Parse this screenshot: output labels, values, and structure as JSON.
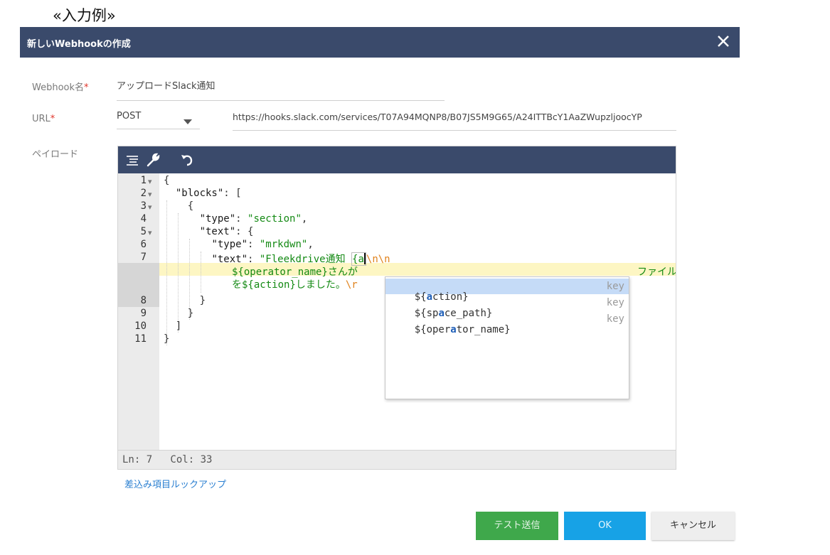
{
  "caption": "«入力例»",
  "dialog": {
    "title": "新しいWebhookの作成",
    "close_icon": "close-icon"
  },
  "form": {
    "name_label": "Webhook名",
    "name_value": "アップロードSlack通知",
    "url_label": "URL",
    "method_value": "POST",
    "url_value": "https://hooks.slack.com/services/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",
    "payload_label": "ペイロード",
    "required_mark": "*"
  },
  "editor": {
    "toolbar_icons": [
      "format-icon",
      "wrench-icon",
      "undo-icon"
    ],
    "line_numbers": [
      "1",
      "2",
      "3",
      "4",
      "5",
      "6",
      "7",
      "8",
      "9",
      "10",
      "11"
    ],
    "code": {
      "l1": "{",
      "l2_key": "\"blocks\"",
      "l2_rest": ": [",
      "l3": "{",
      "l4_key": "\"type\"",
      "l4_colon": ": ",
      "l4_val": "\"section\"",
      "l4_comma": ",",
      "l5_key": "\"text\"",
      "l5_rest": ": {",
      "l6_key": "\"type\"",
      "l6_colon": ": ",
      "l6_val": "\"mrkdwn\"",
      "l6_comma": ",",
      "l7_key": "\"text\"",
      "l7_colon": ": ",
      "l7_val": "\"Fleekdrive通知 ",
      "l7_open": "{a",
      "l7_esc": "\\n\\n",
      "l7b_text": "${operator_name}さんが",
      "l7b_tail": "ファイル",
      "l7c_text": "を${action}しました。",
      "l7c_esc": "\\r",
      "l8": "}",
      "l9": "}",
      "l10": "]",
      "l11": "}"
    },
    "status": "Ln: 7   Col: 33"
  },
  "autocomplete": {
    "items": [
      {
        "pre": "${",
        "match": "a",
        "post": "ction}",
        "meta": "key"
      },
      {
        "pre": "${sp",
        "match": "a",
        "post": "ce_path}",
        "meta": "key"
      },
      {
        "pre": "${oper",
        "match": "a",
        "post": "tor_name}",
        "meta": "key"
      }
    ]
  },
  "lookup_link": "差込み項目ルックアップ",
  "buttons": {
    "test": "テスト送信",
    "ok": "OK",
    "cancel": "キャンセル"
  },
  "colors": {
    "header": "#3a4a6b",
    "required": "#e0352b",
    "test_button": "#3fa84b",
    "ok_button": "#17a2e6",
    "link": "#2a7fd1"
  }
}
